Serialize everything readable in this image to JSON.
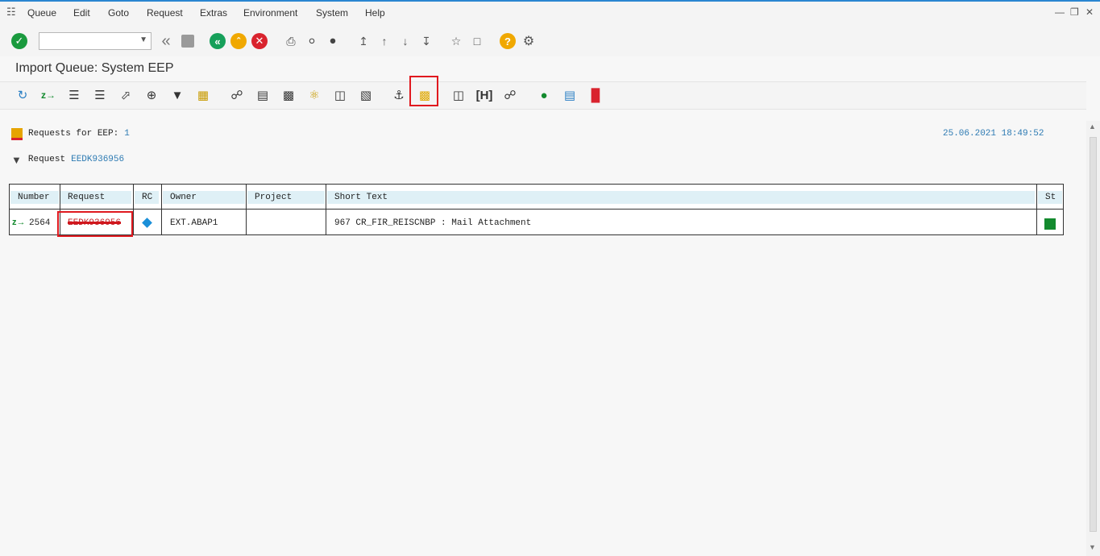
{
  "menu": {
    "items": [
      {
        "label": "Queue"
      },
      {
        "label": "Edit"
      },
      {
        "label": "Goto"
      },
      {
        "label": "Request"
      },
      {
        "label": "Extras"
      },
      {
        "label": "Environment"
      },
      {
        "label": "System"
      },
      {
        "label": "Help"
      }
    ]
  },
  "command_field": {
    "value": ""
  },
  "title": "Import Queue: System EEP",
  "info": {
    "requests_label": "Requests for EEP:",
    "requests_count": "1",
    "datetime": "25.06.2021 18:49:52",
    "filter_label": "Request",
    "filter_value": "EEDK936956"
  },
  "table": {
    "headers": [
      "Number",
      "Request",
      "RC",
      "Owner",
      "Project",
      "Short Text",
      "St"
    ],
    "rows": [
      {
        "number": "2564",
        "request": "EEDK936956",
        "rc": "",
        "owner": "EXT.ABAP1",
        "project": "",
        "short_text": "967 CR_FIR_REISCNBP : Mail Attachment",
        "status": ""
      }
    ]
  },
  "colors": {
    "accent_blue": "#2a86d1",
    "enter_green": "#1a9a3e",
    "back_green": "#16a05a",
    "exit_amber": "#f0a800",
    "cancel_red": "#d9232e",
    "status_green": "#138a2e",
    "rc_diamond": "#1a8fd8",
    "highlight_red": "#e0191f"
  }
}
